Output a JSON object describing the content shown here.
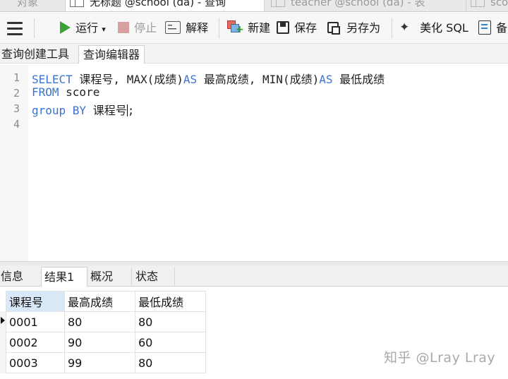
{
  "window_tabs": [
    {
      "label": "对象",
      "active": false,
      "icon": "none"
    },
    {
      "label": "无标题 @school (da) - 查询",
      "active": true,
      "icon": "query-tab-icon"
    },
    {
      "label": "teacher @school (da) - 表",
      "active": false,
      "icon": "table-tab-icon"
    },
    {
      "label": "sco",
      "active": false,
      "icon": "table-tab-icon"
    }
  ],
  "toolbar": {
    "run_label": "运行",
    "run_dropdown": "▾",
    "stop_label": "停止",
    "explain_label": "解释",
    "new_label": "新建",
    "save_label": "保存",
    "saveas_label": "另存为",
    "beautify_label": "美化 SQL",
    "backup_label": "备"
  },
  "subtabs": [
    {
      "label": "查询创建工具",
      "active": false
    },
    {
      "label": "查询编辑器",
      "active": true
    }
  ],
  "editor": {
    "line_numbers": [
      "1",
      "2",
      "3",
      "4"
    ],
    "lines": [
      [
        {
          "t": "SELECT",
          "kw": true
        },
        {
          "t": " 课程号, MAX(成绩)",
          "kw": false
        },
        {
          "t": "AS",
          "kw": true
        },
        {
          "t": " 最高成绩, MIN(成绩)",
          "kw": false
        },
        {
          "t": "AS",
          "kw": true
        },
        {
          "t": " 最低成绩",
          "kw": false
        }
      ],
      [
        {
          "t": "FROM",
          "kw": true
        },
        {
          "t": " score",
          "kw": false
        }
      ],
      [
        {
          "t": "group BY",
          "kw": true
        },
        {
          "t": " 课程号",
          "kw": false
        },
        {
          "t": ";",
          "kw": false
        }
      ],
      []
    ]
  },
  "result_tabs": [
    {
      "label": "信息",
      "active": false
    },
    {
      "label": "结果1",
      "active": true
    },
    {
      "label": "概况",
      "active": false
    },
    {
      "label": "状态",
      "active": false
    }
  ],
  "result_grid": {
    "columns": [
      "课程号",
      "最高成绩",
      "最低成绩"
    ],
    "rows": [
      [
        "0001",
        "80",
        "80"
      ],
      [
        "0002",
        "90",
        "60"
      ],
      [
        "0003",
        "99",
        "80"
      ]
    ]
  },
  "watermark": "知乎 @Lray Lray",
  "colors": {
    "keyword": "#3a73d1",
    "run_green": "#3aa335",
    "header_highlight": "#d9e8f7"
  }
}
